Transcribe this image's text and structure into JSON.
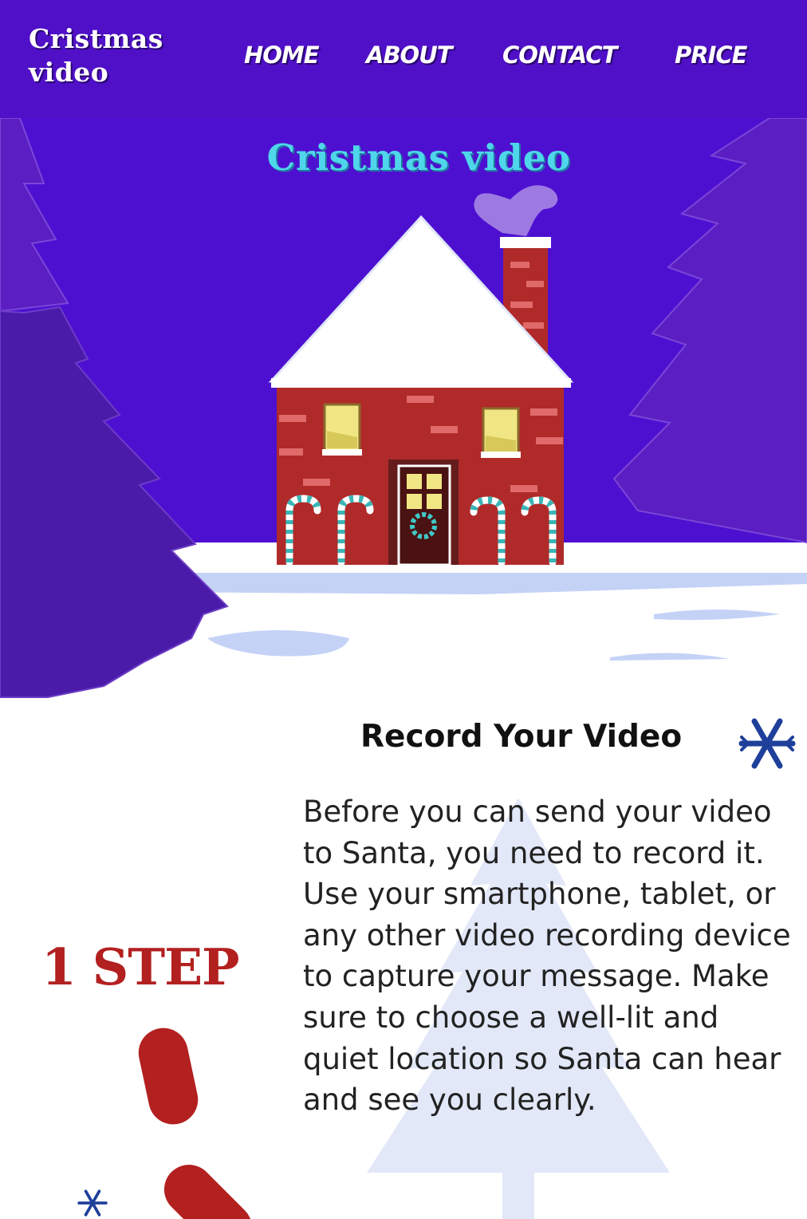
{
  "header": {
    "logo_line1": "Cristmas",
    "logo_line2": "video",
    "nav": {
      "home": "HOME",
      "about": "ABOUT",
      "contact": "CONTACT",
      "price": "PRICE"
    }
  },
  "hero": {
    "title": "Cristmas video"
  },
  "step": {
    "title": "Record Your Video",
    "label": "1 STEP",
    "description": "Before you can send your video to Santa, you need to record it. Use your smartphone, tablet, or any other video recording device to capture your message. Make sure to choose a well-lit and quiet location so Santa can hear and see you clearly."
  },
  "colors": {
    "header_bg": "#5010c8",
    "hero_title": "#4fd6ea",
    "step_red": "#b32020",
    "snowflake": "#1e3f9a"
  },
  "icons": [
    "snowflake-icon",
    "house-illustration",
    "tree-illustration"
  ]
}
